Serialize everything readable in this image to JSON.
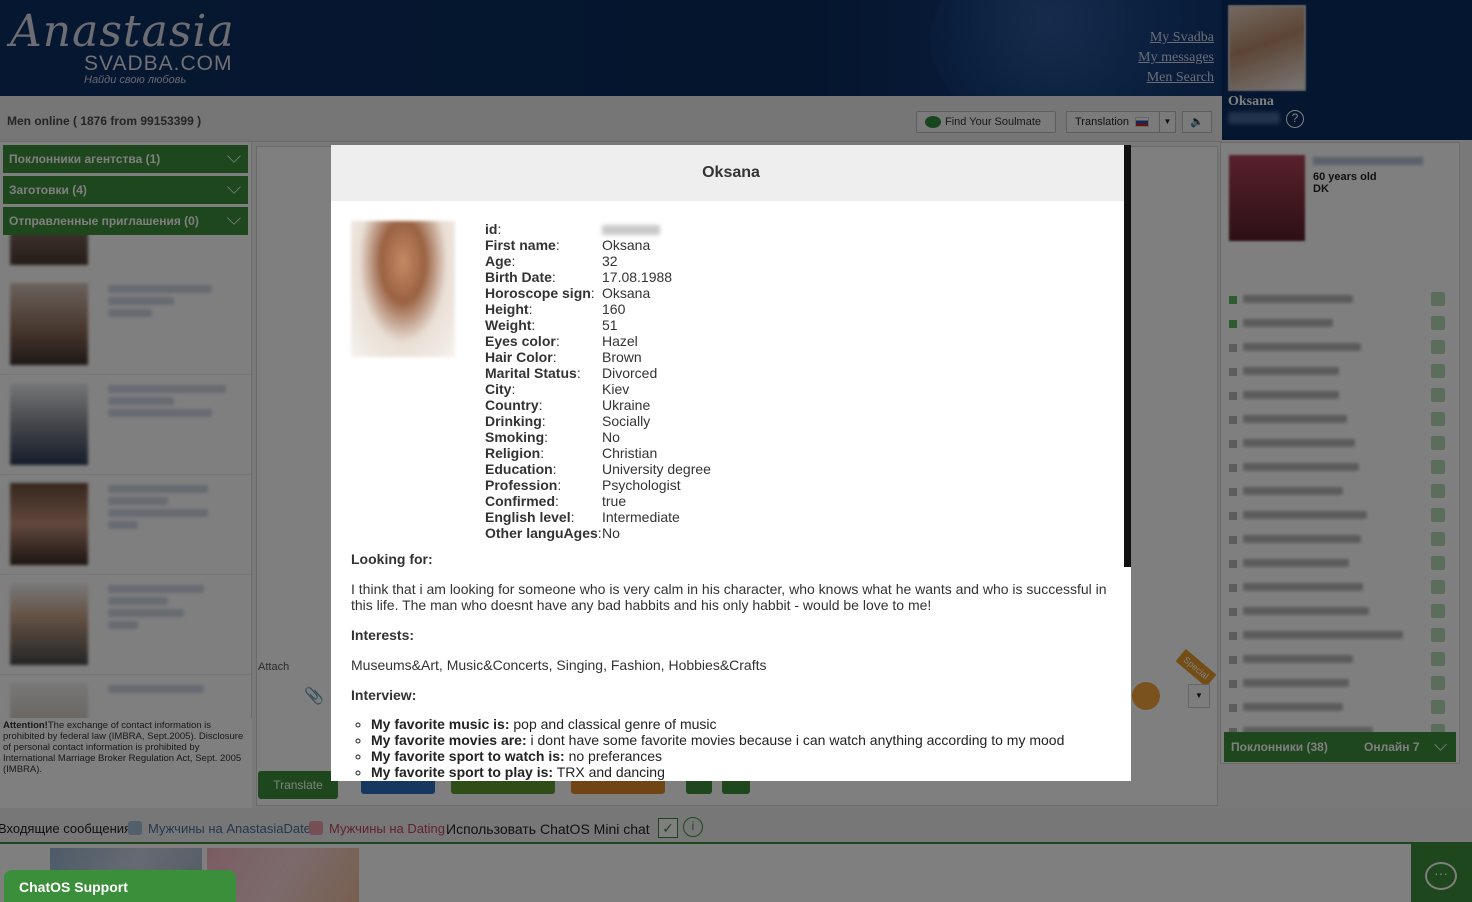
{
  "header": {
    "logo_script": "Anastasia",
    "logo_site": "SVADBA.COM",
    "logo_tagline": "Найди свою любовь",
    "links": [
      "My Svadba",
      "My messages",
      "Men Search"
    ],
    "user_name": "Oksana"
  },
  "toolbar": {
    "men_online": "Men online ( 1876 from 99153399 )",
    "soulmate_button": "Find Your Soulmate",
    "translation_label": "Translation"
  },
  "left_panel": {
    "accordions": [
      "Поклонники агентства (1)",
      "Заготовки (4)",
      "Отправленные приглашения (0)"
    ],
    "attention_title": "Attention!",
    "attention_text": "The exchange of contact information is prohibited by federal law (IMBRA, Sept.2005). Disclosure of personal contact information is prohibited by International Marriage Broker Regulation Act, Sept. 2005 (IMBRA)."
  },
  "center": {
    "attach_label": "Attach",
    "translate_button": "Translate",
    "special_tag": "Special"
  },
  "right_panel": {
    "fav_age": "60 years old",
    "fav_country": "DK",
    "fans_label": "Поклонники (38)",
    "online_label": "Онлайн 7"
  },
  "bottom": {
    "incoming": "Входящие сообщения",
    "men_anastasia": "Мужчины на AnastasiaDate",
    "men_dating": "Мужчины на Dating",
    "use_chatos": "Использовать ChatOS Mini chat",
    "chatos_support": "ChatOS Support"
  },
  "colors": {
    "brand_green": "#3c8f3a",
    "header_blue": "#0d2f63",
    "check_blue": "#a9bfd9",
    "check_red": "#e8a0a8"
  },
  "modal": {
    "title": "Oksana",
    "fields": [
      {
        "label": "id",
        "value": ""
      },
      {
        "label": "First name",
        "value": "Oksana"
      },
      {
        "label": "Age",
        "value": "32"
      },
      {
        "label": "Birth Date",
        "value": "17.08.1988"
      },
      {
        "label": "Horoscope sign",
        "value": "Oksana"
      },
      {
        "label": "Height",
        "value": "160"
      },
      {
        "label": "Weight",
        "value": "51"
      },
      {
        "label": "Eyes color",
        "value": "Hazel"
      },
      {
        "label": "Hair Color",
        "value": "Brown"
      },
      {
        "label": "Marital Status",
        "value": "Divorced"
      },
      {
        "label": "City",
        "value": "Kiev"
      },
      {
        "label": "Country",
        "value": "Ukraine"
      },
      {
        "label": "Drinking",
        "value": "Socially"
      },
      {
        "label": "Smoking",
        "value": "No"
      },
      {
        "label": "Religion",
        "value": "Christian"
      },
      {
        "label": "Education",
        "value": "University degree"
      },
      {
        "label": "Profession",
        "value": "Psychologist"
      },
      {
        "label": "Confirmed",
        "value": "true"
      },
      {
        "label": "English level",
        "value": "Intermediate"
      },
      {
        "label": "Other languAges",
        "value": "No"
      }
    ],
    "looking_for_title": "Looking for",
    "looking_for_text": "I think that i am looking for someone who is very calm in his character, who knows what he wants and who is successful in this life. The man who doesnt have any bad habbits and his only habbit - would be love to me!",
    "interests_title": "Interests",
    "interests_text": "Museums&Art, Music&Concerts, Singing, Fashion, Hobbies&Crafts",
    "interview_title": "Interview",
    "interview": [
      {
        "q": "My favorite music is:",
        "a": "pop and classical genre of music"
      },
      {
        "q": "My favorite movies are:",
        "a": "i dont have some favorite movies because i can watch anything according to my mood"
      },
      {
        "q": "My favorite sport to watch is:",
        "a": "no preferances"
      },
      {
        "q": "My favorite sport to play is:",
        "a": "TRX and dancing"
      }
    ]
  }
}
